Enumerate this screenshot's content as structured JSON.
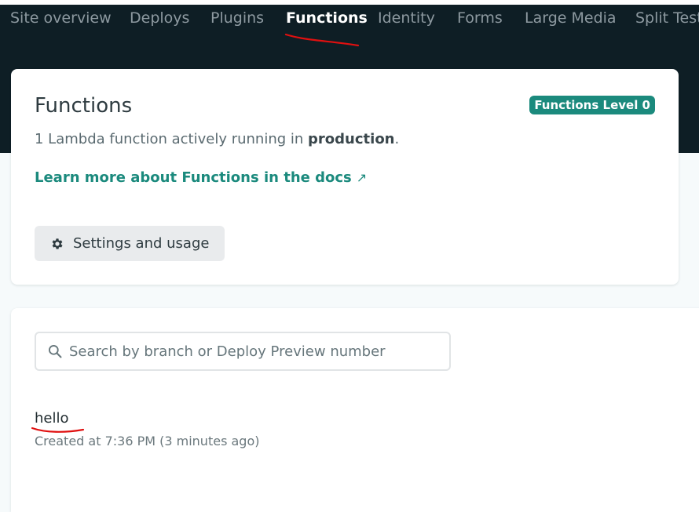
{
  "nav": {
    "tabs": [
      {
        "label": "Site overview",
        "active": false
      },
      {
        "label": "Deploys",
        "active": false
      },
      {
        "label": "Plugins",
        "active": false
      },
      {
        "label": "Functions",
        "active": true
      },
      {
        "label": "Identity",
        "active": false
      },
      {
        "label": "Forms",
        "active": false
      },
      {
        "label": "Large Media",
        "active": false
      },
      {
        "label": "Split Testing",
        "active": false
      }
    ]
  },
  "overview": {
    "title": "Functions",
    "badge": "Functions Level 0",
    "desc_prefix": "1 Lambda function actively running in",
    "desc_env": "production",
    "desc_suffix": ".",
    "docs_link": "Learn more about Functions in the docs",
    "docs_arrow": "↗",
    "settings_button": "Settings and usage"
  },
  "list": {
    "search_placeholder": "Search by branch or Deploy Preview number",
    "items": [
      {
        "name": "hello",
        "meta": "Created at 7:36 PM (3 minutes ago)"
      }
    ]
  },
  "colors": {
    "topbar": "#0e1e25",
    "accent": "#1b8a7d",
    "annotation": "#e01010"
  }
}
